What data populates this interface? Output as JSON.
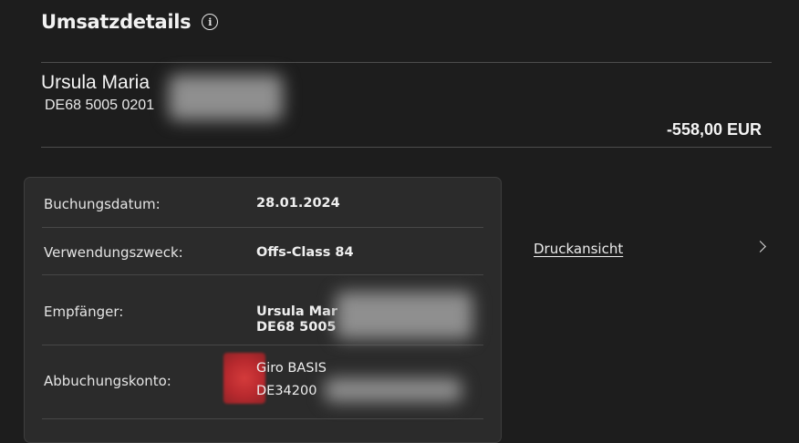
{
  "page": {
    "title": "Umsatzdetails",
    "info_icon": "info-icon"
  },
  "header": {
    "name": "Ursula Maria",
    "iban": "DE68 5005 0201",
    "amount": "-558,00 EUR"
  },
  "details": [
    {
      "label": "Buchungsdatum:",
      "value": "28.01.2024"
    },
    {
      "label": "Verwendungszweck:",
      "value": "Offs-Class 84"
    },
    {
      "label": "Empfänger:",
      "value_line1": "Ursula Mar",
      "value_line2": "DE68 5005"
    },
    {
      "label": "Abbuchungskonto:",
      "value_line1": "Giro BASIS",
      "value_line2": "DE34200"
    }
  ],
  "actions": {
    "print_label": "Druckansicht",
    "chevron_icon": "chevron-right-icon"
  }
}
